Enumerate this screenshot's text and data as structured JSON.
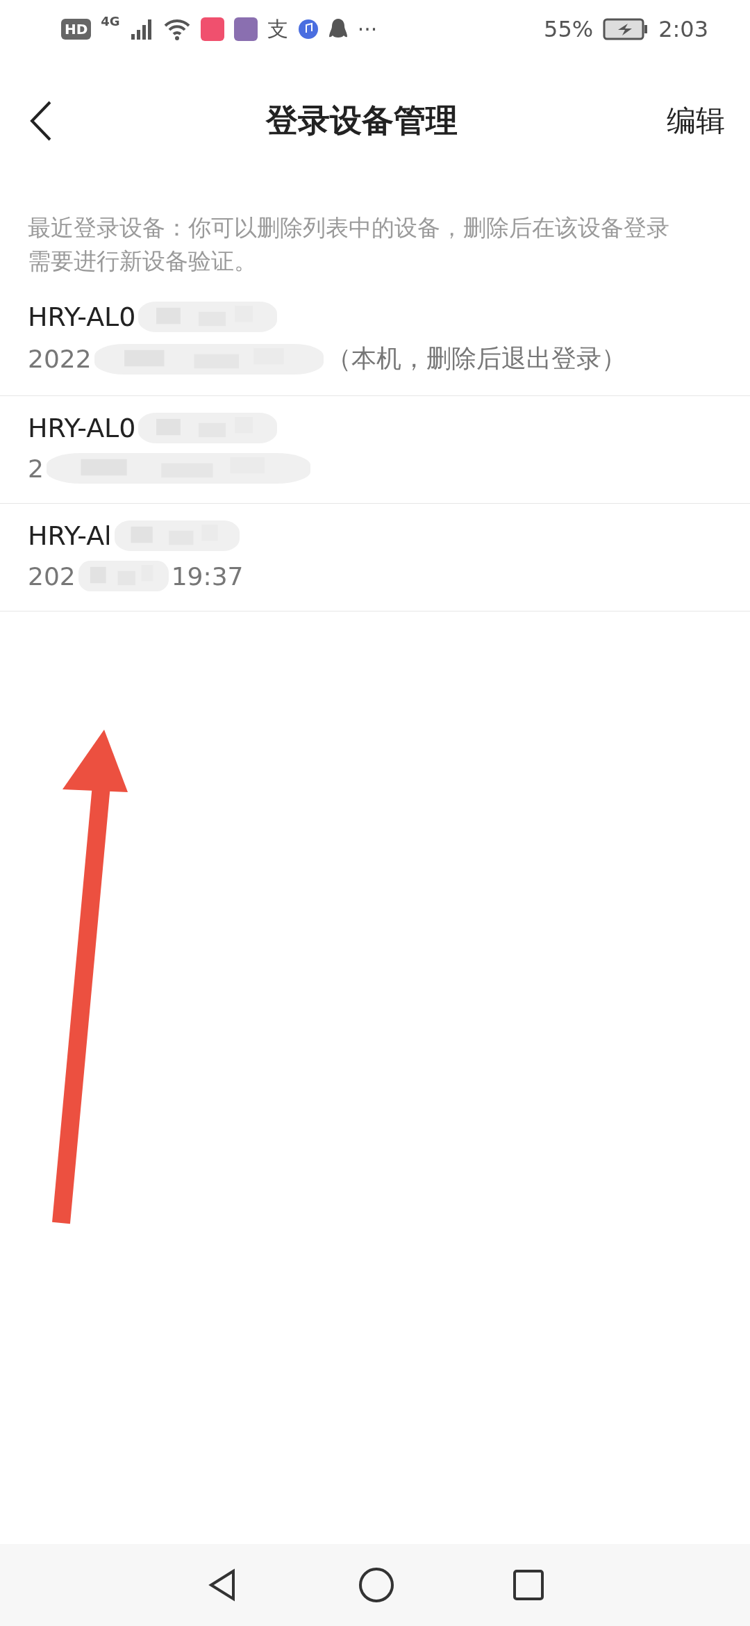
{
  "status_bar": {
    "hd": "HD",
    "network": "4G",
    "glyph": "支",
    "more": "···",
    "battery": "55%",
    "time": "2:03"
  },
  "header": {
    "title": "登录设备管理",
    "action": "编辑"
  },
  "notice": "最近登录设备：你可以删除列表中的设备，删除后在该设备登录需要进行新设备验证。",
  "devices": [
    {
      "name": "HRY-AL0",
      "date": "2022",
      "note": "（本机，删除后退出登录）"
    },
    {
      "name": "HRY-AL0",
      "date": "2"
    },
    {
      "name": "HRY-Al",
      "date": "202",
      "note": "19:37"
    }
  ]
}
